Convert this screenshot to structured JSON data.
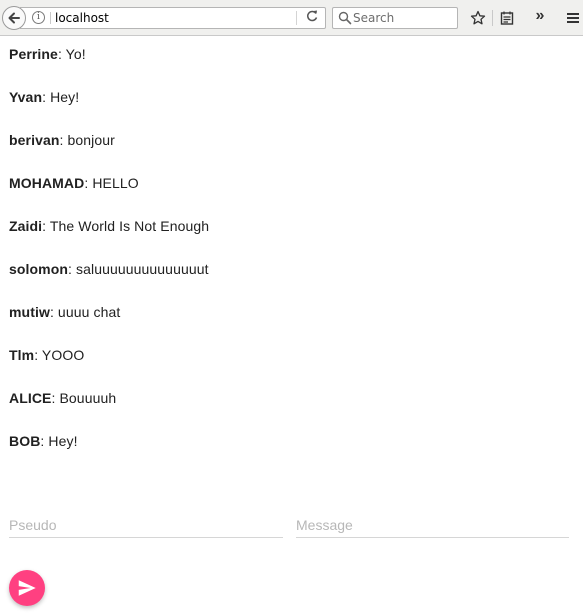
{
  "browser": {
    "url": "localhost",
    "search_placeholder": "Search",
    "info_glyph": "i",
    "overflow_glyph": "»",
    "icons": [
      "back-arrow-icon",
      "info-icon",
      "reload-icon",
      "search-icon",
      "bookmark-star-icon",
      "reading-list-icon",
      "overflow-chevron-icon",
      "menu-hamburger-icon"
    ]
  },
  "chat": {
    "messages": [
      {
        "user": "Perrine",
        "text": ": Yo!"
      },
      {
        "user": "Yvan",
        "text": ": Hey!"
      },
      {
        "user": "berivan",
        "text": ": bonjour"
      },
      {
        "user": "MOHAMAD",
        "text": ": HELLO"
      },
      {
        "user": "Zaidi",
        "text": ": The World Is Not Enough"
      },
      {
        "user": "solomon",
        "text": ": saluuuuuuuuuuuuuut"
      },
      {
        "user": "mutiw",
        "text": ": uuuu chat"
      },
      {
        "user": "Tlm",
        "text": ": YOOO"
      },
      {
        "user": "ALICE",
        "text": ": Bouuuuh"
      },
      {
        "user": "BOB",
        "text": ": Hey!"
      }
    ]
  },
  "form": {
    "pseudo_placeholder": "Pseudo",
    "message_placeholder": "Message",
    "send_icon": "send-icon"
  },
  "colors": {
    "accent": "#ff4081",
    "toolbar_bg": "#f0f0ee"
  }
}
